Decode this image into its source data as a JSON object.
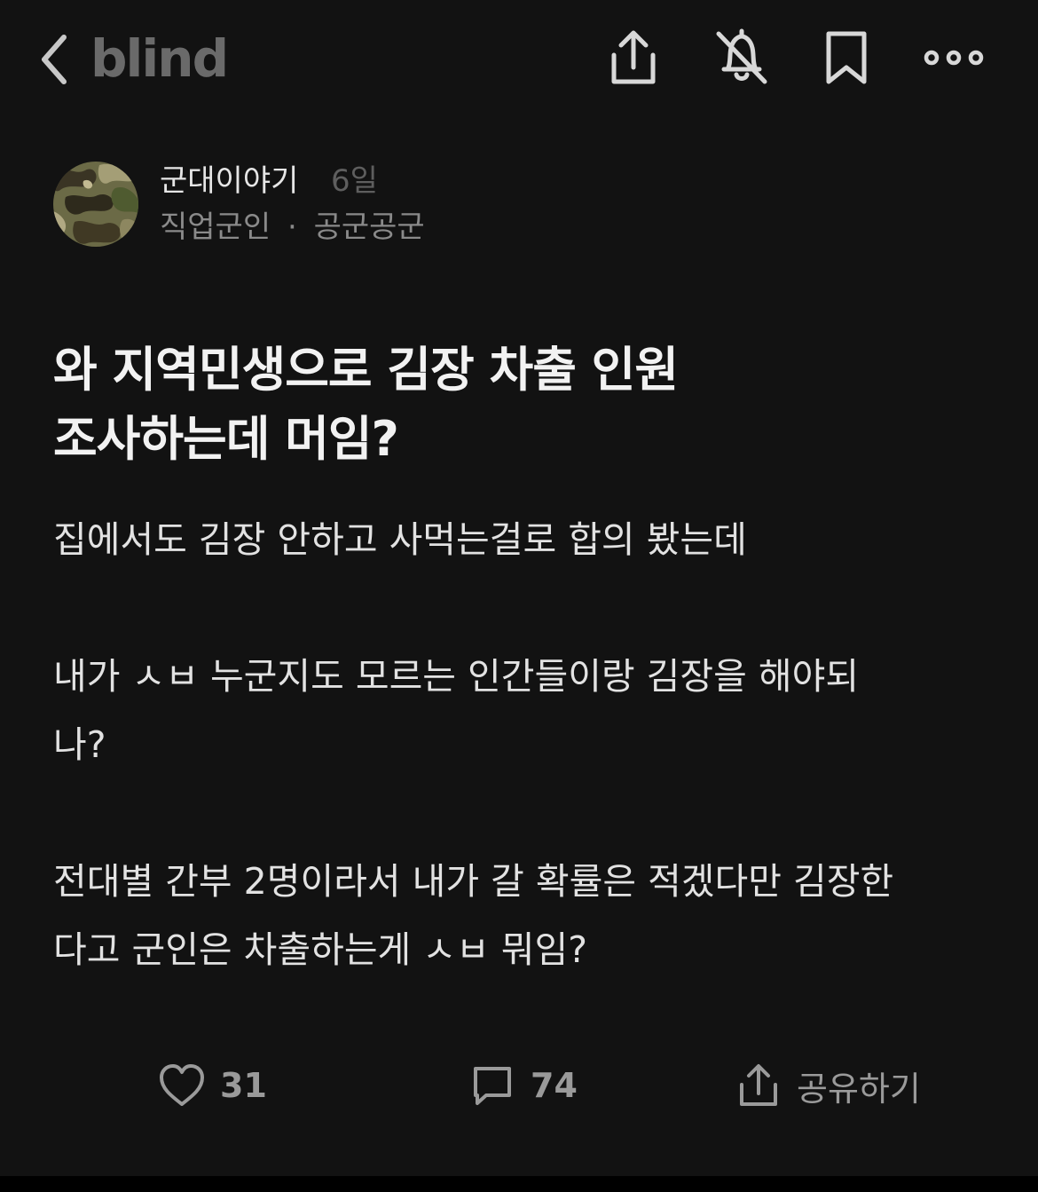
{
  "app": {
    "logo_text": "blind"
  },
  "topbar": {
    "icons": [
      "chevron-left-icon",
      "share-icon",
      "bell-off-icon",
      "bookmark-icon",
      "more-icon"
    ]
  },
  "author": {
    "name": "군대이야기",
    "time": "6일",
    "job": "직업군인",
    "separator": "·",
    "company": "공군공군",
    "avatar_icon": "camouflage-avatar"
  },
  "post": {
    "title_line1": "와 지역민생으로 김장 차출 인원",
    "title_line2": "조사하는데 머임?",
    "paragraphs": [
      {
        "line1": "집에서도 김장 안하고 사먹는걸로 합의 봤는데"
      },
      {
        "line1": "내가 ㅅㅂ 누군지도 모르는 인간들이랑 김장을 해야되",
        "line2": "나?"
      },
      {
        "line1": "전대별 간부 2명이라서 내가 갈 확률은 적겠다만 김장한",
        "line2": "다고 군인은 차출하는게 ㅅㅂ 뭐임?"
      }
    ]
  },
  "actions": {
    "likes": "31",
    "comments": "74",
    "share_label": "공유하기"
  },
  "colors": {
    "background": "#121212",
    "muted": "#9a9a9a"
  }
}
